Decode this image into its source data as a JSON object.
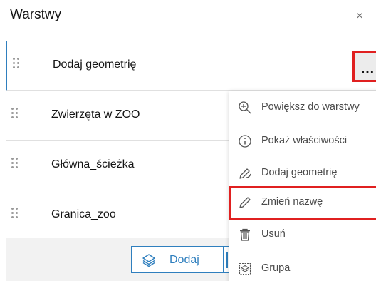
{
  "panel": {
    "title": "Warstwy",
    "close_glyph": "×"
  },
  "layers": [
    {
      "label": "Dodaj geometrię",
      "active": true
    },
    {
      "label": "Zwierzęta w ZOO"
    },
    {
      "label": "Główna_ścieżka"
    },
    {
      "label": "Granica_zoo"
    }
  ],
  "more_button": {
    "icon": "more-horizontal-icon",
    "glyph": "…"
  },
  "footer": {
    "add_label": "Dodaj",
    "add_icon": "layers-icon"
  },
  "context_menu": {
    "items": [
      {
        "label": "Powiększ do warstwy",
        "icon": "zoom-in-icon"
      },
      {
        "label": "Pokaż właściwości",
        "icon": "info-icon"
      },
      {
        "label": "Dodaj geometrię",
        "icon": "edit-geometry-icon"
      },
      {
        "label": "Zmień nazwę",
        "icon": "pencil-icon",
        "highlighted": true
      },
      {
        "label": "Usuń",
        "icon": "trash-icon"
      },
      {
        "label": "Grupa",
        "icon": "group-icon"
      }
    ]
  },
  "colors": {
    "accent": "#2f7fbe",
    "highlight_border": "#e02020",
    "footer_bg": "#f2f2f2"
  }
}
